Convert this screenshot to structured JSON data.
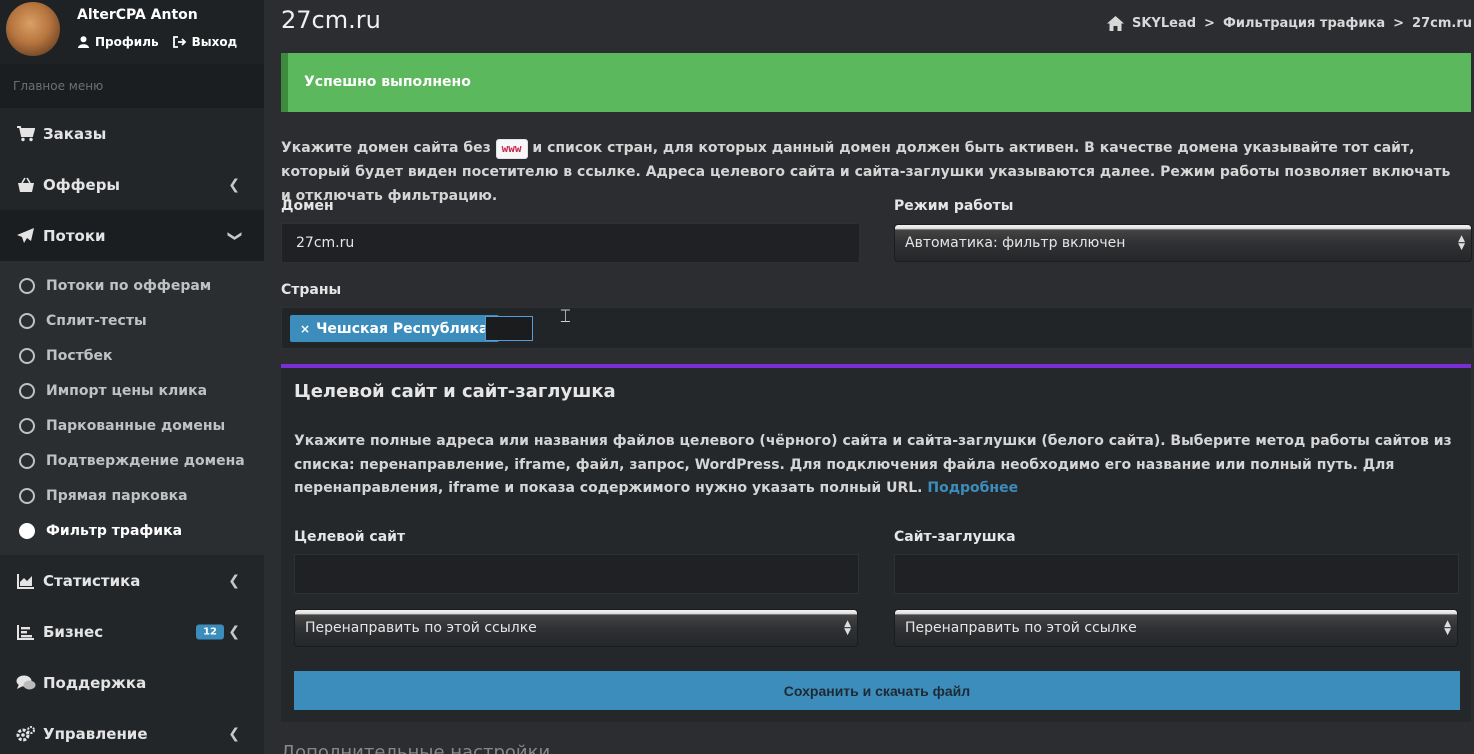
{
  "user": {
    "name": "AlterCPA Anton",
    "profile_label": "Профиль",
    "logout_label": "Выход"
  },
  "sidebar": {
    "header": "Главное меню",
    "items": [
      {
        "label": "Заказы",
        "icon": "cart-icon"
      },
      {
        "label": "Офферы",
        "icon": "basket-icon"
      },
      {
        "label": "Потоки",
        "icon": "paper-plane-icon"
      },
      {
        "label": "Статистика",
        "icon": "area-chart-icon"
      },
      {
        "label": "Бизнес",
        "icon": "bar-chart-icon",
        "badge": "12"
      },
      {
        "label": "Поддержка",
        "icon": "comments-icon"
      },
      {
        "label": "Управление",
        "icon": "cogs-icon"
      }
    ],
    "subitems": [
      {
        "label": "Потоки по офферам"
      },
      {
        "label": "Сплит-тесты"
      },
      {
        "label": "Постбек"
      },
      {
        "label": "Импорт цены клика"
      },
      {
        "label": "Паркованные домены"
      },
      {
        "label": "Подтверждение домена"
      },
      {
        "label": "Прямая парковка"
      },
      {
        "label": "Фильтр трафика"
      }
    ]
  },
  "page": {
    "title": "27cm.ru",
    "breadcrumb": [
      "SKYLead",
      "Фильтрация трафика",
      "27cm.ru"
    ],
    "alert": "Успешно выполнено",
    "intro_part1": "Укажите домен сайта без",
    "intro_code": "www",
    "intro_part2": "и список стран, для которых данный домен должен быть активен. В качестве домена указывайте тот сайт, который будет виден посетителю в ссылке. Адреса целевого сайта и сайта-заглушки указываются далее. Режим работы позволяет включать и отключать фильтрацию."
  },
  "form": {
    "domain_label": "Домен",
    "domain_value": "27cm.ru",
    "mode_label": "Режим работы",
    "mode_value": "Автоматика: фильтр включен",
    "countries_label": "Страны",
    "country_tag": "Чешская Республика"
  },
  "box": {
    "title": "Целевой сайт и сайт-заглушка",
    "text": "Укажите полные адреса или названия файлов целевого (чёрного) сайта и сайта-заглушки (белого сайта). Выберите метод работы сайтов из списка: перенаправление, iframe, файл, запрос, WordPress. Для подключения файла необходимо его название или полный путь. Для перенаправления, iframe и показа содержимого нужно указать полный URL.",
    "link": "Подробнее",
    "target_label": "Целевой сайт",
    "stub_label": "Сайт-заглушка",
    "target_method": "Перенаправить по этой ссылке",
    "stub_method": "Перенаправить по этой ссылке",
    "save_label": "Сохранить и скачать файл"
  },
  "footer_heading": "Дополнительные настройки",
  "colors": {
    "alert": "#5cb85c",
    "accent": "#3c8dbc",
    "box_border": "#7a2fd4"
  }
}
